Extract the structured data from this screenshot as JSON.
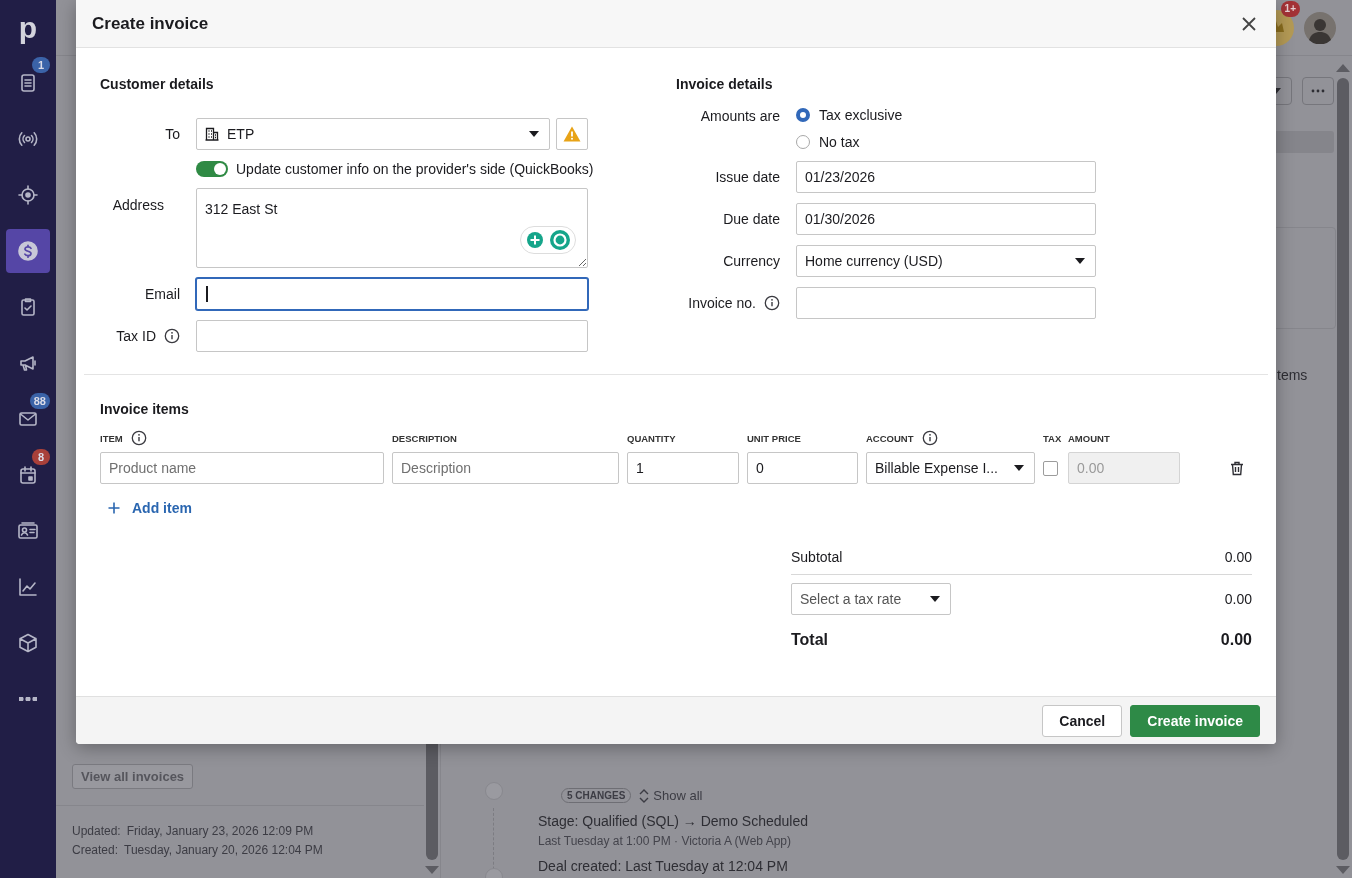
{
  "sidebar": {
    "logo": "p",
    "items": [
      {
        "kind": "list",
        "selected": false,
        "badge": {
          "text": "1",
          "color": "#3b63a8"
        }
      },
      {
        "kind": "broadcast",
        "selected": false
      },
      {
        "kind": "target",
        "selected": false
      },
      {
        "kind": "dollar",
        "selected": true
      },
      {
        "kind": "clipboard",
        "selected": false
      },
      {
        "kind": "megaphone",
        "selected": false
      },
      {
        "kind": "mail",
        "selected": false,
        "badge": {
          "text": "88",
          "color": "#3b63a8"
        }
      },
      {
        "kind": "calendar",
        "selected": false,
        "badge": {
          "text": "8",
          "color": "#a8403a"
        }
      },
      {
        "kind": "card",
        "selected": false
      },
      {
        "kind": "chart",
        "selected": false
      },
      {
        "kind": "box",
        "selected": false
      },
      {
        "kind": "more",
        "selected": false
      }
    ]
  },
  "header": {
    "notification_badge": "1+"
  },
  "background": {
    "right_label": "tems",
    "left_panel": {
      "button": "View all invoices",
      "updated_label": "Updated:",
      "updated": "Friday, January 23, 2026 12:09 PM",
      "created_label": "Created:",
      "created": "Tuesday, January 20, 2026 12:04 PM"
    },
    "timeline": {
      "changes_badge": "5 CHANGES",
      "show_all": "Show all",
      "entries": [
        {
          "title": "Stage: Qualified (SQL) → Demo Scheduled",
          "meta": "Last Tuesday at 1:00 PM · Victoria A (Web App)"
        },
        {
          "title": "Deal created: Last Tuesday at 12:04 PM"
        }
      ]
    }
  },
  "modal": {
    "title": "Create invoice",
    "customer": {
      "heading": "Customer details",
      "to": {
        "label": "To",
        "value": "ETP"
      },
      "sync_toggle": {
        "label": "Update customer info on the provider's side (QuickBooks)",
        "on": true
      },
      "address": {
        "label": "Address",
        "value": "312 East St"
      },
      "email": {
        "label": "Email",
        "focused": true
      },
      "tax_id": {
        "label": "Tax ID"
      }
    },
    "invoice": {
      "heading": "Invoice details",
      "amounts": {
        "label": "Amounts are",
        "options": [
          {
            "label": "Tax exclusive",
            "selected": true
          },
          {
            "label": "No tax",
            "selected": false
          }
        ]
      },
      "issue_date": {
        "label": "Issue date",
        "value": "01/23/2026"
      },
      "due_date": {
        "label": "Due date",
        "value": "01/30/2026"
      },
      "currency": {
        "label": "Currency",
        "value": "Home currency (USD)"
      },
      "invoice_no": {
        "label": "Invoice no."
      }
    },
    "items": {
      "heading": "Invoice items",
      "columns": [
        {
          "label": "ITEM",
          "info": true
        },
        {
          "label": "DESCRIPTION",
          "info": false
        },
        {
          "label": "QUANTITY",
          "info": false
        },
        {
          "label": "UNIT PRICE",
          "info": false
        },
        {
          "label": "ACCOUNT",
          "info": true
        },
        {
          "label": "TAX",
          "info": false
        },
        {
          "label": "AMOUNT",
          "info": false
        }
      ],
      "rows": [
        {
          "item_placeholder": "Product name",
          "description_placeholder": "Description",
          "quantity": "1",
          "unit_price": "0",
          "account": "Billable Expense I...",
          "tax": false,
          "amount": "0.00",
          "amount_disabled": true
        }
      ],
      "add_item": "Add item"
    },
    "totals": {
      "subtotal_label": "Subtotal",
      "subtotal": "0.00",
      "tax_rate_placeholder": "Select a tax rate",
      "tax": "0.00",
      "total_label": "Total",
      "total": "0.00"
    },
    "buttons": [
      {
        "label": "Cancel",
        "kind": "secondary"
      },
      {
        "label": "Create invoice",
        "kind": "primary"
      }
    ]
  }
}
